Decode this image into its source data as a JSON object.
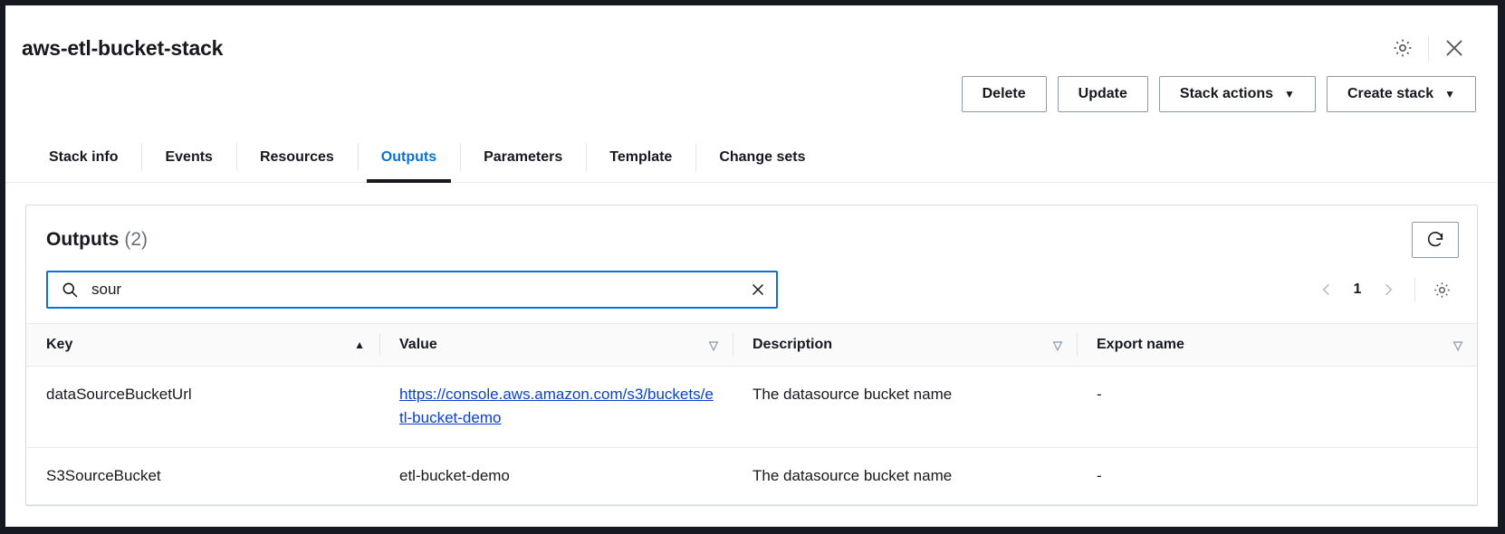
{
  "window": {
    "title": "aws-etl-bucket-stack",
    "settings_icon": "gear-icon",
    "close_icon": "close-icon"
  },
  "toolbar": {
    "delete_label": "Delete",
    "update_label": "Update",
    "stack_actions_label": "Stack actions",
    "create_stack_label": "Create stack",
    "caret": "▼"
  },
  "tabs": [
    {
      "label": "Stack info",
      "active": false
    },
    {
      "label": "Events",
      "active": false
    },
    {
      "label": "Resources",
      "active": false
    },
    {
      "label": "Outputs",
      "active": true
    },
    {
      "label": "Parameters",
      "active": false
    },
    {
      "label": "Template",
      "active": false
    },
    {
      "label": "Change sets",
      "active": false
    }
  ],
  "outputs_card": {
    "title": "Outputs",
    "count": "(2)",
    "refresh_icon": "refresh-icon",
    "search": {
      "value": "sour",
      "placeholder": "Find outputs",
      "search_icon": "search-icon",
      "clear_icon": "clear-icon"
    },
    "pagination": {
      "prev": "‹",
      "page": "1",
      "next": "›",
      "settings_icon": "gear-icon"
    },
    "columns": [
      {
        "label": "Key",
        "sort": "▲",
        "sort_active": true
      },
      {
        "label": "Value",
        "sort": "▽",
        "sort_active": false
      },
      {
        "label": "Description",
        "sort": "▽",
        "sort_active": false
      },
      {
        "label": "Export name",
        "sort": "▽",
        "sort_active": false
      }
    ],
    "rows": [
      {
        "key": "dataSourceBucketUrl",
        "value": "https://console.aws.amazon.com/s3/buckets/etl-bucket-demo",
        "value_is_link": true,
        "description": "The datasource bucket name",
        "export_name": "-"
      },
      {
        "key": "S3SourceBucket",
        "value": "etl-bucket-demo",
        "value_is_link": false,
        "description": "The datasource bucket name",
        "export_name": "-"
      }
    ]
  },
  "colors": {
    "accent_blue": "#0972d3",
    "link_blue": "#0b42cc",
    "text_dark": "#16191f",
    "muted": "#687078",
    "border": "#d5dbdb",
    "frame_dark": "#16191f"
  }
}
